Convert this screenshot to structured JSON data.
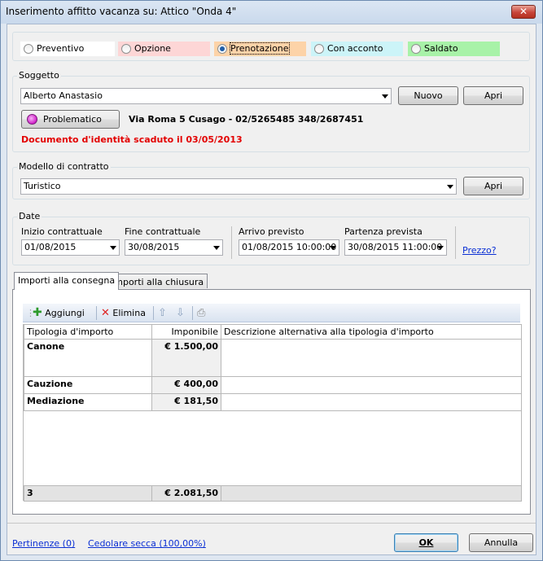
{
  "window": {
    "title": "Inserimento affitto vacanza su: Attico  \"Onda 4\"",
    "close_glyph": "✕"
  },
  "status": {
    "options": [
      {
        "label": "Preventivo",
        "color": "#ffffff",
        "selected": false
      },
      {
        "label": "Opzione",
        "color": "#fdd6d6",
        "selected": false
      },
      {
        "label": "Prenotazione",
        "color": "#fdd3a8",
        "selected": true
      },
      {
        "label": "Con acconto",
        "color": "#ccf4f8",
        "selected": false
      },
      {
        "label": "Saldato",
        "color": "#a8f2a8",
        "selected": false
      }
    ]
  },
  "soggetto": {
    "group_label": "Soggetto",
    "value": "Alberto  Anastasio",
    "new_label": "Nuovo",
    "open_label": "Apri",
    "problem_label": "Problematico",
    "address": "Via Roma 5 Cusago - 02/5265485   348/2687451",
    "warning": "Documento d'identità scaduto il 03/05/2013"
  },
  "modello": {
    "group_label": "Modello di contratto",
    "value": "Turistico",
    "open_label": "Apri"
  },
  "date": {
    "group_label": "Date",
    "fields": [
      {
        "label": "Inizio contrattuale",
        "value": "01/08/2015"
      },
      {
        "label": "Fine contrattuale",
        "value": "30/08/2015"
      },
      {
        "label": "Arrivo previsto",
        "value": "01/08/2015 10:00:00"
      },
      {
        "label": "Partenza prevista",
        "value": "30/08/2015 11:00:00"
      }
    ],
    "price_link": "Prezzo?"
  },
  "tabs": [
    {
      "label": "Importi alla consegna",
      "active": true
    },
    {
      "label": "Importi alla chiusura",
      "active": false
    }
  ],
  "toolbar": {
    "add_label": "Aggiungi",
    "delete_label": "Elimina"
  },
  "table": {
    "columns": [
      "Tipologia d'importo",
      "Imponibile",
      "Descrizione alternativa alla tipologia d'importo"
    ],
    "rows": [
      {
        "type": "Canone",
        "amount": "€ 1.500,00",
        "desc": ""
      },
      {
        "type": "Cauzione",
        "amount": "€ 400,00",
        "desc": ""
      },
      {
        "type": "Mediazione",
        "amount": "€ 181,50",
        "desc": ""
      }
    ],
    "footer": {
      "count": "3",
      "total": "€ 2.081,50"
    }
  },
  "bottom": {
    "pertinenze": "Pertinenze (0)",
    "cedolare": "Cedolare secca (100,00%)",
    "ok_label": "OK",
    "cancel_label": "Annulla"
  }
}
